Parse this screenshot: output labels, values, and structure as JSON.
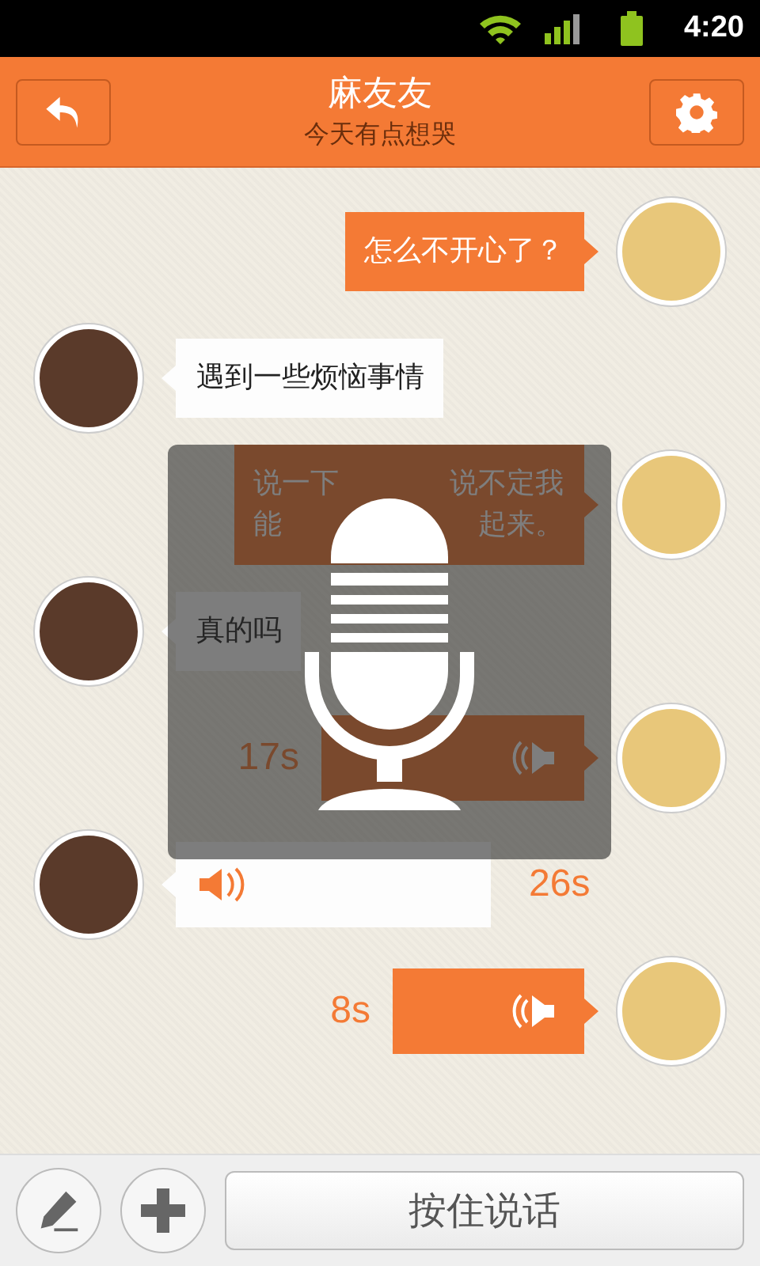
{
  "status_bar": {
    "time": "4:20"
  },
  "header": {
    "title": "麻友友",
    "subtitle": "今天有点想哭"
  },
  "messages": [
    {
      "outgoing": true,
      "kind": "text",
      "lines": [
        [
          "怎么不开心了？"
        ]
      ]
    },
    {
      "outgoing": false,
      "kind": "text",
      "lines": [
        [
          "遇到一些烦恼事情"
        ]
      ]
    },
    {
      "outgoing": true,
      "kind": "text",
      "lines": [
        [
          "说一下",
          "说不定我"
        ],
        [
          "能",
          "起来。"
        ]
      ]
    },
    {
      "outgoing": false,
      "kind": "text",
      "lines": [
        [
          "真的吗"
        ]
      ]
    },
    {
      "outgoing": true,
      "kind": "voice",
      "duration": "17s"
    },
    {
      "outgoing": false,
      "kind": "voice",
      "duration": "26s"
    },
    {
      "outgoing": true,
      "kind": "voice",
      "duration": "8s"
    }
  ],
  "recording_overlay": {
    "visible": true
  },
  "input_bar": {
    "talk_button": "按住说话"
  }
}
